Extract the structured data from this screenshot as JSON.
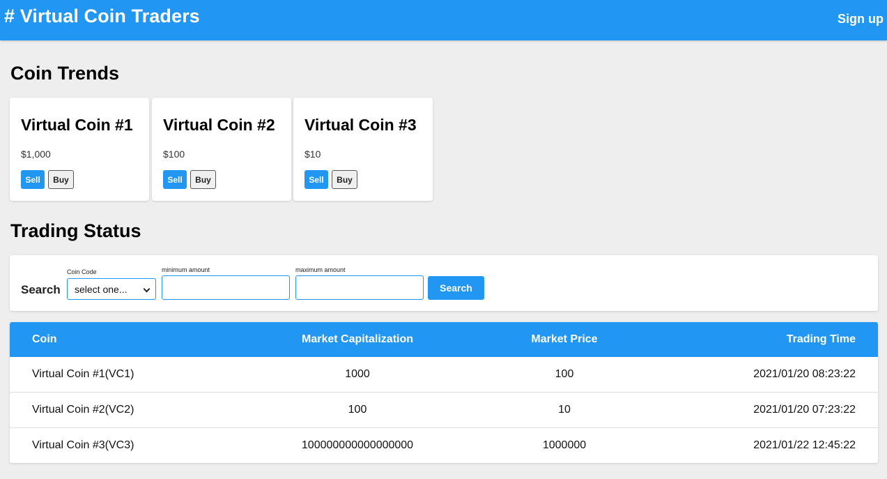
{
  "header": {
    "title": "# Virtual Coin Traders",
    "signup_label": "Sign up"
  },
  "trends": {
    "title": "Coin Trends",
    "cards": [
      {
        "name": "Virtual Coin #1",
        "price": "$1,000",
        "sell_label": "Sell",
        "buy_label": "Buy"
      },
      {
        "name": "Virtual Coin #2",
        "price": "$100",
        "sell_label": "Sell",
        "buy_label": "Buy"
      },
      {
        "name": "Virtual Coin #3",
        "price": "$10",
        "sell_label": "Sell",
        "buy_label": "Buy"
      }
    ]
  },
  "status": {
    "title": "Trading Status",
    "search": {
      "label": "Search",
      "coin_code_label": "Coin Code",
      "coin_code_value": "select one...",
      "min_label": "minimum amount",
      "min_value": "",
      "max_label": "maximum amount",
      "max_value": "",
      "button_label": "Search"
    },
    "table": {
      "headers": [
        "Coin",
        "Market Capitalization",
        "Market Price",
        "Trading Time"
      ],
      "rows": [
        [
          "Virtual Coin #1(VC1)",
          "1000",
          "100",
          "2021/01/20 08:23:22"
        ],
        [
          "Virtual Coin #2(VC2)",
          "100",
          "10",
          "2021/01/20 07:23:22"
        ],
        [
          "Virtual Coin #3(VC3)",
          "100000000000000000",
          "1000000",
          "2021/01/22 12:45:22"
        ]
      ]
    }
  },
  "colors": {
    "primary": "#2196f3",
    "background": "#eeeeee"
  }
}
